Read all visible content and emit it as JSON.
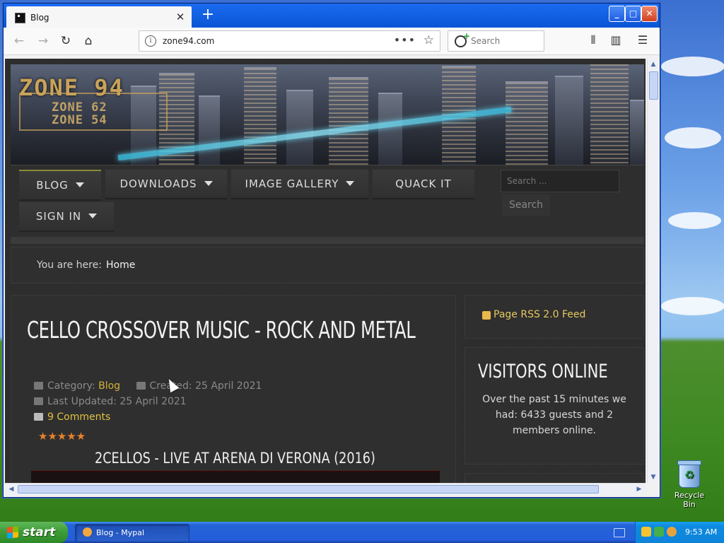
{
  "browser": {
    "tab_title": "Blog",
    "url": "zone94.com",
    "search_placeholder": "Search",
    "page_actions": "•••",
    "new_tab": "+",
    "tab_close": "✕",
    "minimize": "_",
    "maximize": "□",
    "close": "✕"
  },
  "site": {
    "logo": {
      "line1": "ZONE 94",
      "line2": "ZONE 62",
      "line3": "ZONE 54"
    },
    "menu": [
      {
        "label": "BLOG",
        "dropdown": true,
        "active": true
      },
      {
        "label": "DOWNLOADS",
        "dropdown": true
      },
      {
        "label": "IMAGE GALLERY",
        "dropdown": true
      },
      {
        "label": "QUACK IT",
        "dropdown": false
      },
      {
        "label": "SIGN IN",
        "dropdown": true
      }
    ],
    "search_placeholder": "Search ...",
    "search_button": "Search",
    "breadcrumb": {
      "label": "You are here:",
      "home": "Home"
    },
    "article": {
      "title": "CELLO CROSSOVER MUSIC - ROCK AND METAL",
      "category_label": "Category:",
      "category": "Blog",
      "created": "Created: 25 April 2021",
      "updated": "Last Updated: 25 April 2021",
      "comments": "9 Comments",
      "stars": "★★★★★",
      "rating": 5,
      "subtitle": "2CELLOS - LIVE AT ARENA DI VERONA (2016)"
    },
    "sidebar": {
      "rss": "Page RSS 2.0 Feed",
      "visitors_title": "VISITORS ONLINE",
      "visitors_text": "Over the past 15 minutes we had: 6433 guests and 2 members online."
    }
  },
  "desktop": {
    "recycle_bin": "Recycle Bin"
  },
  "taskbar": {
    "start": "start",
    "task": "Blog - Mypal",
    "time": "9:53 AM"
  },
  "colors": {
    "accent_gold": "#d4b23a",
    "star_orange": "#e6822c",
    "xp_blue": "#245edb",
    "xp_green": "#3c9a35"
  }
}
